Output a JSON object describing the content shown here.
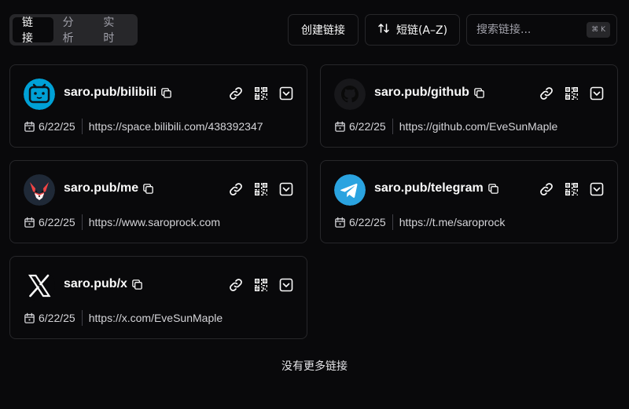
{
  "tabs": [
    {
      "label": "链接",
      "active": true
    },
    {
      "label": "分析",
      "active": false
    },
    {
      "label": "实时",
      "active": false
    }
  ],
  "toolbar": {
    "create_label": "创建链接",
    "sort_label": "短链(A–Z)",
    "sort_icon": "arrow-up-down-icon"
  },
  "search": {
    "placeholder": "搜索链接...",
    "shortcut": "⌘ K"
  },
  "links": [
    {
      "slug": "saro.pub/bilibili",
      "date": "6/22/25",
      "url": "https://space.bilibili.com/438392347",
      "avatar": "bilibili-logo"
    },
    {
      "slug": "saro.pub/github",
      "date": "6/22/25",
      "url": "https://github.com/EveSunMaple",
      "avatar": "github-logo"
    },
    {
      "slug": "saro.pub/me",
      "date": "6/22/25",
      "url": "https://www.saroprock.com",
      "avatar": "fox-avatar"
    },
    {
      "slug": "saro.pub/telegram",
      "date": "6/22/25",
      "url": "https://t.me/saroprock",
      "avatar": "telegram-logo"
    },
    {
      "slug": "saro.pub/x",
      "date": "6/22/25",
      "url": "https://x.com/EveSunMaple",
      "avatar": "x-logo"
    }
  ],
  "icons": {
    "copy": "copy-icon",
    "link": "link-icon",
    "qr": "qr-code-icon",
    "menu": "chevron-down-square-icon",
    "date": "calendar-icon"
  },
  "colors": {
    "background": "#09090b",
    "border": "#27272a",
    "muted": "#a1a1aa",
    "bilibili": "#00a1d6",
    "telegram": "#2aa3e0"
  },
  "footer": "没有更多链接"
}
